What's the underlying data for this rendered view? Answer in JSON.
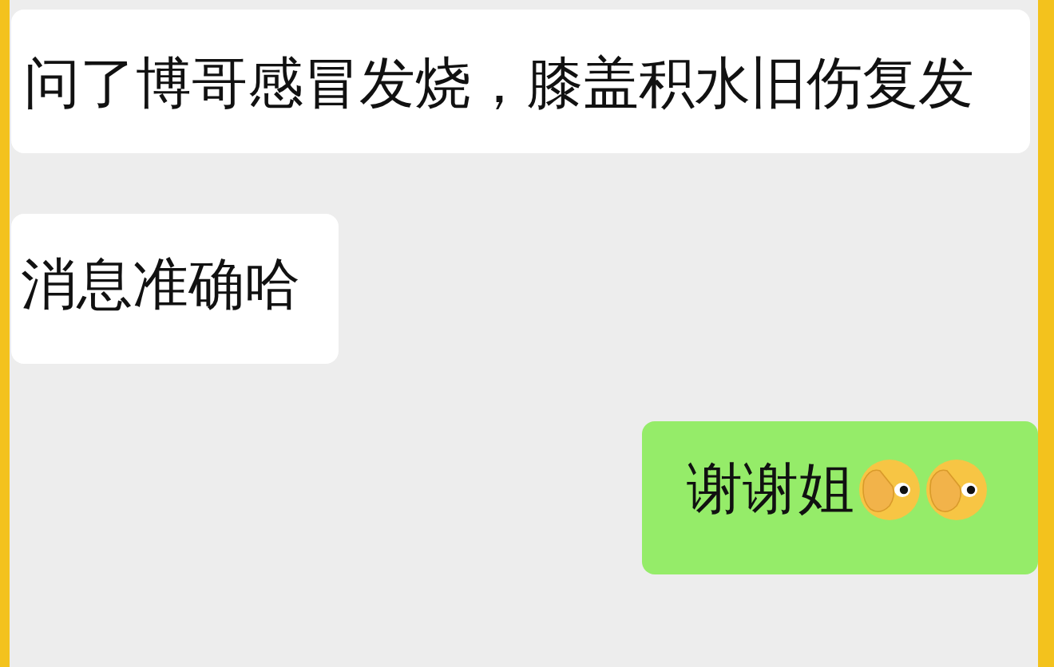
{
  "messages": [
    {
      "kind": "incoming",
      "text": "问了博哥感冒发烧，膝盖积水旧伤复发"
    },
    {
      "kind": "incoming",
      "text": "消息准确哈"
    },
    {
      "kind": "outgoing",
      "text": "谢谢姐",
      "stickers": [
        {
          "kind": "emoji"
        },
        {
          "kind": "emoji"
        }
      ]
    }
  ]
}
